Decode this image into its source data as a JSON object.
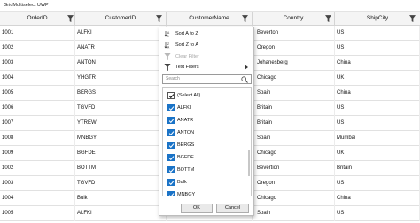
{
  "window": {
    "title": "GridMultiselect UWP"
  },
  "columns": [
    {
      "key": "order_id",
      "label": "OrderID"
    },
    {
      "key": "customer_id",
      "label": "CustomerID"
    },
    {
      "key": "customer_name",
      "label": "CustomerName"
    },
    {
      "key": "country",
      "label": "Country"
    },
    {
      "key": "ship_city",
      "label": "ShipCity"
    }
  ],
  "rows": [
    [
      "1001",
      "ALFKI",
      "",
      "Beverton",
      "US"
    ],
    [
      "1002",
      "ANATR",
      "",
      "Oregon",
      "US"
    ],
    [
      "1003",
      "ANTON",
      "",
      "Johanesberg",
      "China"
    ],
    [
      "1004",
      "YHGTR",
      "",
      "Chicago",
      "UK"
    ],
    [
      "1005",
      "BERGS",
      "",
      "Spain",
      "China"
    ],
    [
      "1006",
      "TGVFD",
      "",
      "Britain",
      "US"
    ],
    [
      "1007",
      "YTREW",
      "",
      "Britain",
      "US"
    ],
    [
      "1008",
      "MNBGY",
      "",
      "Spain",
      "Mumbai"
    ],
    [
      "1009",
      "BGFDE",
      "",
      "Chicago",
      "UK"
    ],
    [
      "1002",
      "BOTTM",
      "",
      "Bevertion",
      "Britain"
    ],
    [
      "1003",
      "TGVFD",
      "",
      "Oregon",
      "US"
    ],
    [
      "1004",
      "Bulk",
      "",
      "Chicago",
      "China"
    ],
    [
      "1005",
      "ALFKI",
      "",
      "Spain",
      "US"
    ]
  ],
  "filter_menu": {
    "sort_asc": "Sort A to Z",
    "sort_desc": "Sort Z to A",
    "clear_filter": "Clear Filter",
    "text_filters": "Text Filters",
    "search_placeholder": "Search",
    "items": [
      {
        "label": "(Select All)",
        "checked": true
      },
      {
        "label": "ALFKI",
        "checked": true
      },
      {
        "label": "ANATR",
        "checked": true
      },
      {
        "label": "ANTON",
        "checked": true
      },
      {
        "label": "BERGS",
        "checked": true
      },
      {
        "label": "BGFDE",
        "checked": true
      },
      {
        "label": "BOTTM",
        "checked": true
      },
      {
        "label": "Bulk",
        "checked": true
      },
      {
        "label": "MNBGY",
        "checked": true
      }
    ],
    "ok_label": "OK",
    "cancel_label": "Cancel"
  }
}
